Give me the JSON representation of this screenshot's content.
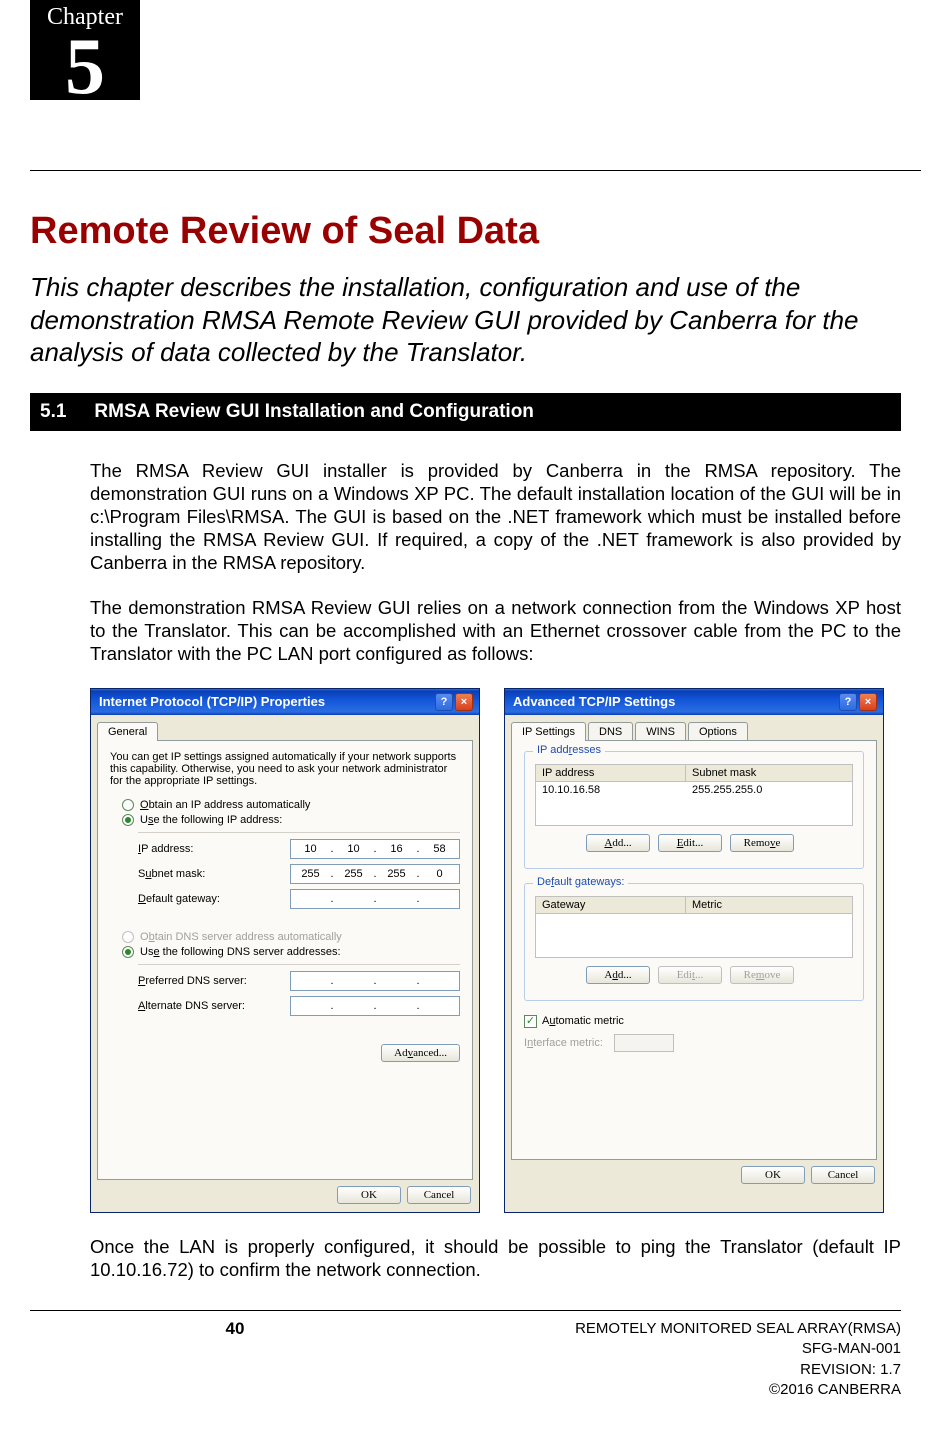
{
  "chapter": {
    "label": "Chapter",
    "number": "5"
  },
  "title": "Remote Review of Seal Data",
  "intro": "This chapter describes the installation, configuration and use of the demonstration RMSA Remote Review GUI provided by Canberra for the analysis of data collected by the Translator.",
  "section": {
    "num": "5.1",
    "title": "RMSA Review GUI Installation and Configuration"
  },
  "para1": "The RMSA Review GUI installer is provided by Canberra in the RMSA repository.  The demonstration GUI runs on a Windows XP PC.  The default installation location of the GUI will be in c:\\Program Files\\RMSA.  The GUI is based on the .NET framework which must be installed before installing the RMSA Review GUI.  If required, a copy of the .NET framework is also provided by Canberra in the RMSA repository.",
  "para2": "The demonstration RMSA Review GUI relies on a network connection from the Windows XP host to the Translator.  This can be accomplished with an Ethernet crossover cable from the PC to the Translator with the PC LAN port configured as follows:",
  "para3": "Once the LAN is properly configured, it should be possible to ping the Translator (default IP 10.10.16.72) to confirm the network connection.",
  "dlg1": {
    "title": "Internet Protocol (TCP/IP) Properties",
    "tab": "General",
    "desc": "You can get IP settings assigned automatically if your network supports this capability. Otherwise, you need to ask your network administrator for the appropriate IP settings.",
    "r1": "Obtain an IP address automatically",
    "r2": "Use the following IP address:",
    "ip_label": "IP address:",
    "ip_val": [
      "10",
      "10",
      "16",
      "58"
    ],
    "mask_label": "Subnet mask:",
    "mask_val": [
      "255",
      "255",
      "255",
      "0"
    ],
    "gw_label": "Default gateway:",
    "r3": "Obtain DNS server address automatically",
    "r4": "Use the following DNS server addresses:",
    "pdns": "Preferred DNS server:",
    "adns": "Alternate DNS server:",
    "advanced": "Advanced...",
    "ok": "OK",
    "cancel": "Cancel"
  },
  "dlg2": {
    "title": "Advanced TCP/IP Settings",
    "tabs": [
      "IP Settings",
      "DNS",
      "WINS",
      "Options"
    ],
    "ipaddr_legend": "IP addresses",
    "ipaddr_h1": "IP address",
    "ipaddr_h2": "Subnet mask",
    "ipaddr_row": [
      "10.10.16.58",
      "255.255.255.0"
    ],
    "gw_legend": "Default gateways:",
    "gw_h1": "Gateway",
    "gw_h2": "Metric",
    "add": "Add...",
    "edit": "Edit...",
    "remove": "Remove",
    "auto_metric": "Automatic metric",
    "if_metric": "Interface metric:",
    "ok": "OK",
    "cancel": "Cancel"
  },
  "footer": {
    "page": "40",
    "l1": "REMOTELY MONITORED SEAL ARRAY(RMSA)",
    "l2": "SFG-MAN-001",
    "l3": "REVISION: 1.7",
    "l4": "©2016 CANBERRA"
  }
}
